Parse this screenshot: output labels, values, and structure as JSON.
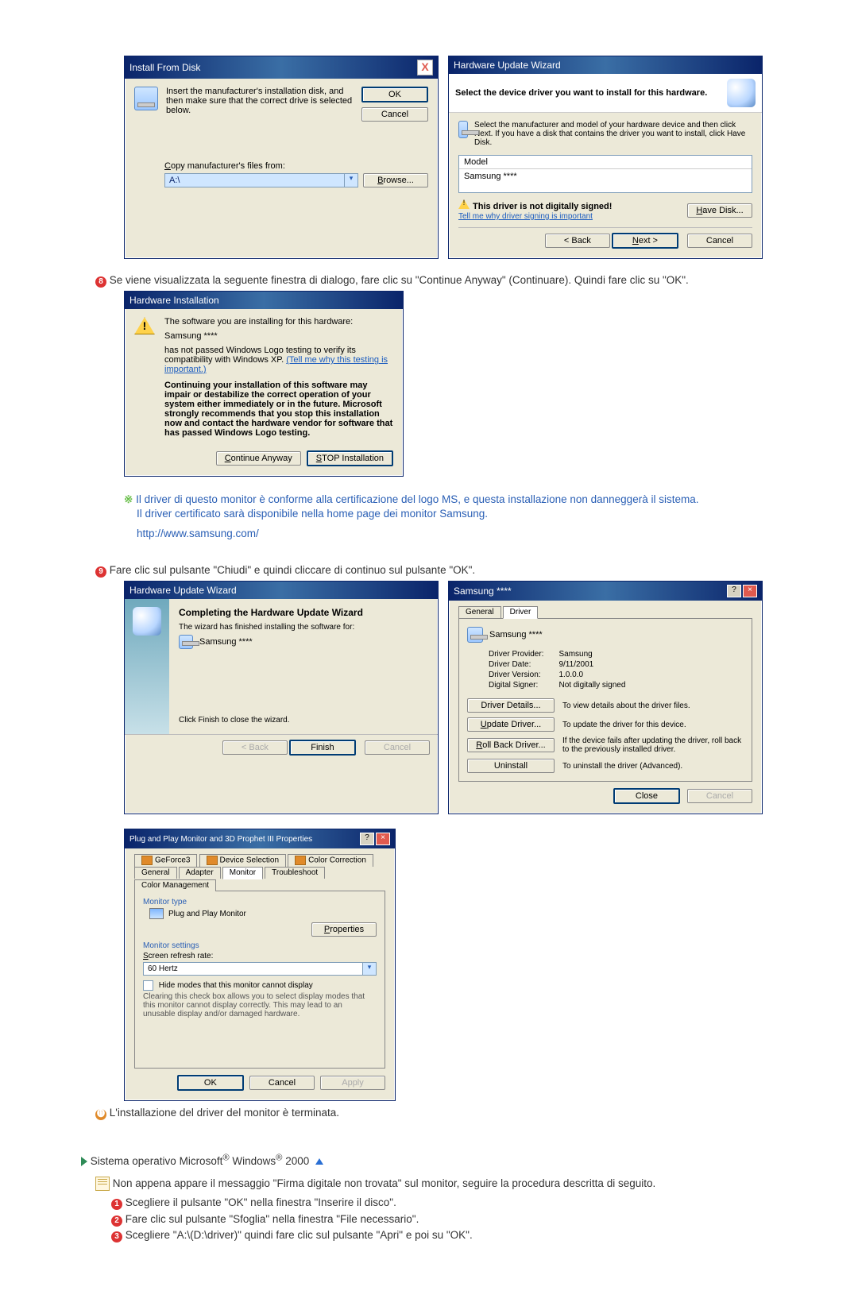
{
  "dlg_install_from_disk": {
    "title": "Install From Disk",
    "body_text": "Insert the manufacturer's installation disk, and then make sure that the correct drive is selected below.",
    "ok": "OK",
    "cancel": "Cancel",
    "copy_label": "Copy manufacturer's files from:",
    "path_value": "A:\\",
    "browse": "Browse..."
  },
  "dlg_huw_select": {
    "title": "Hardware Update Wizard",
    "heading": "Select the device driver you want to install for this hardware.",
    "body_text": "Select the manufacturer and model of your hardware device and then click Next. If you have a disk that contains the driver you want to install, click Have Disk.",
    "model_label": "Model",
    "model_value": "Samsung ****",
    "warn_text": "This driver is not digitally signed!",
    "warn_link": "Tell me why driver signing is important",
    "have_disk": "Have Disk...",
    "back": "< Back",
    "next": "Next >",
    "cancel": "Cancel"
  },
  "step8_text": "Se viene visualizzata la seguente finestra di dialogo, fare clic su \"Continue Anyway\" (Continuare). Quindi fare clic su \"OK\".",
  "dlg_hw_install": {
    "title": "Hardware Installation",
    "line1": "The software you are installing for this hardware:",
    "device": "Samsung ****",
    "line2": "has not passed Windows Logo testing to verify its compatibility with Windows XP.",
    "line2_link": "(Tell me why this testing is important.)",
    "bold_block": "Continuing your installation of this software may impair or destabilize the correct operation of your system either immediately or in the future. Microsoft strongly recommends that you stop this installation now and contact the hardware vendor for software that has passed Windows Logo testing.",
    "continue": "Continue Anyway",
    "stop": "STOP Installation"
  },
  "note": {
    "line1": "Il driver di questo monitor è conforme alla certificazione del logo MS, e questa installazione non danneggerà il sistema.",
    "line2": "Il driver certificato sarà disponibile nella home page dei monitor Samsung.",
    "url": "http://www.samsung.com/"
  },
  "step9_text": "Fare clic sul pulsante \"Chiudi\" e quindi cliccare di continuo sul pulsante \"OK\".",
  "dlg_huw_complete": {
    "title": "Hardware Update Wizard",
    "heading": "Completing the Hardware Update Wizard",
    "line": "The wizard has finished installing the software for:",
    "device": "Samsung ****",
    "footer": "Click Finish to close the wizard.",
    "back": "< Back",
    "finish": "Finish",
    "cancel": "Cancel"
  },
  "dlg_driver_props": {
    "title": "Samsung ****",
    "tab_general": "General",
    "tab_driver": "Driver",
    "device": "Samsung ****",
    "provider_lbl": "Driver Provider:",
    "provider_val": "Samsung",
    "date_lbl": "Driver Date:",
    "date_val": "9/11/2001",
    "version_lbl": "Driver Version:",
    "version_val": "1.0.0.0",
    "signer_lbl": "Digital Signer:",
    "signer_val": "Not digitally signed",
    "btn_details": "Driver Details...",
    "btn_details_desc": "To view details about the driver files.",
    "btn_update": "Update Driver...",
    "btn_update_desc": "To update the driver for this device.",
    "btn_rollback": "Roll Back Driver...",
    "btn_rollback_desc": "If the device fails after updating the driver, roll back to the previously installed driver.",
    "btn_uninstall": "Uninstall",
    "btn_uninstall_desc": "To uninstall the driver (Advanced).",
    "close": "Close",
    "cancel": "Cancel"
  },
  "dlg_pnp": {
    "title": "Plug and Play Monitor and 3D Prophet III Properties",
    "tabs_top": [
      "GeForce3",
      "Device Selection",
      "Color Correction"
    ],
    "tabs_bottom": [
      "General",
      "Adapter",
      "Monitor",
      "Troubleshoot",
      "Color Management"
    ],
    "mt_label": "Monitor type",
    "mt_value": "Plug and Play Monitor",
    "properties": "Properties",
    "ms_label": "Monitor settings",
    "refresh_lbl": "Screen refresh rate:",
    "refresh_val": "60 Hertz",
    "hide_chk": "Hide modes that this monitor cannot display",
    "hide_desc": "Clearing this check box allows you to select display modes that this monitor cannot display correctly. This may lead to an unusable display and/or damaged hardware.",
    "ok": "OK",
    "cancel": "Cancel",
    "apply": "Apply"
  },
  "step10_text": "L'installazione del driver del monitor è terminata.",
  "os_line": {
    "pre": "Sistema operativo Microsoft",
    "mid": " Windows",
    "suffix": " 2000"
  },
  "win2000": {
    "intro": "Non appena appare il messaggio \"Firma digitale non trovata\" sul monitor, seguire la procedura descritta di seguito.",
    "s1": "Scegliere il pulsante \"OK\" nella finestra \"Inserire il disco\".",
    "s2": "Fare clic sul pulsante \"Sfoglia\" nella finestra \"File necessario\".",
    "s3": "Scegliere \"A:\\(D:\\driver)\" quindi fare clic sul pulsante \"Apri\" e poi su \"OK\"."
  }
}
